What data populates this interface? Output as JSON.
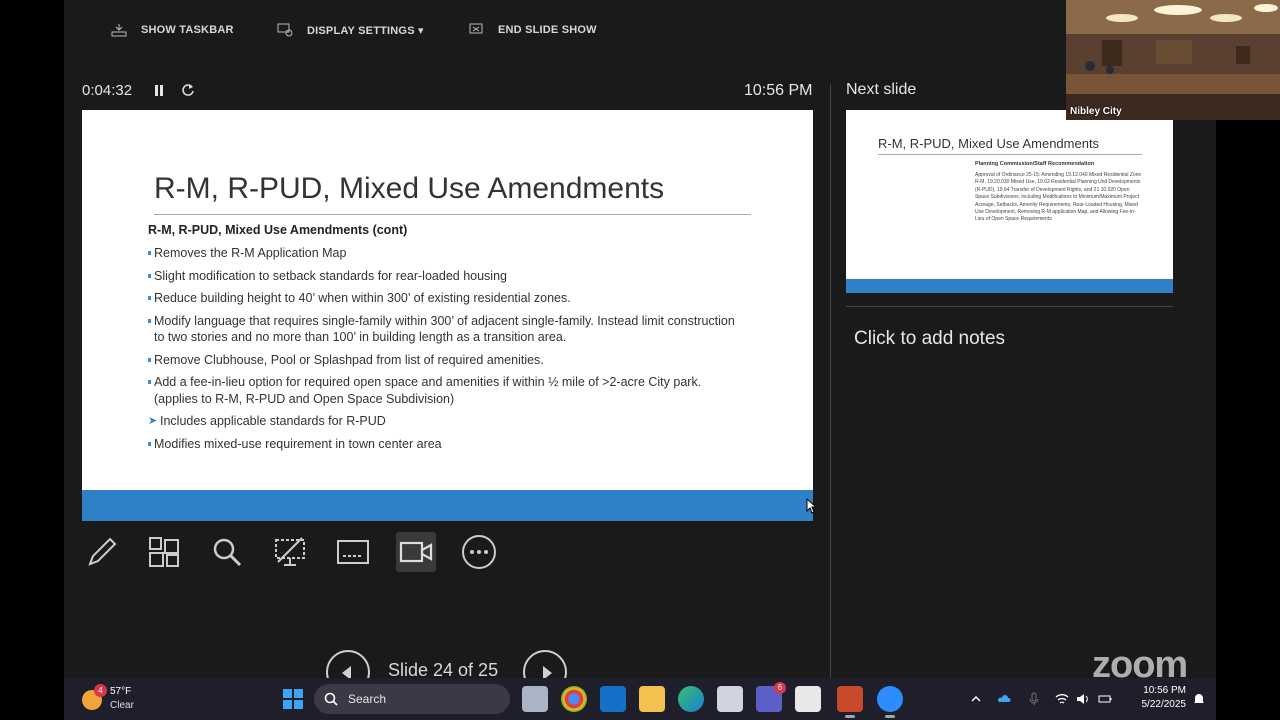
{
  "topbar": {
    "show_taskbar": "SHOW TASKBAR",
    "display_settings": "DISPLAY SETTINGS ▾",
    "end_slide_show": "END SLIDE SHOW"
  },
  "presenter": {
    "timer": "0:04:32",
    "clock": "10:56 PM",
    "next_slide_label": "Next slide",
    "notes_placeholder": "Click to add notes",
    "slide_counter": "Slide 24 of 25"
  },
  "current_slide": {
    "title": "R-M, R-PUD, Mixed Use Amendments",
    "subtitle": "R-M, R-PUD, Mixed Use Amendments (cont)",
    "bullets": [
      "Removes the R-M Application Map",
      "Slight modification to setback standards for rear-loaded housing",
      "Reduce building height to 40’ when within 300’ of existing residential zones.",
      "Modify language that requires single-family within 300’ of adjacent single-family. Instead limit construction to two stories and no more than 100’ in building length as a transition area.",
      "Remove Clubhouse, Pool or Splashpad from list of required amenities.",
      "Add a fee-in-lieu option for required open space and amenities if within ½ mile of >2-acre City park. (applies to R-M, R-PUD and Open Space Subdivision)",
      "Includes applicable standards for R-PUD",
      "Modifies mixed-use requirement in town center area"
    ]
  },
  "next_slide": {
    "title": "R-M, R-PUD, Mixed Use Amendments",
    "heading": "Planning Commission/Staff Recommendation",
    "body": "Approval of Ordinance 25-15: Amending 19.12.040 Mixed Residential Zone R-M, 19.20.030 Mixed Use, 19.62 Residential Planning Unit Developments (R-PUD), 19.64 Transfer of Development Rights, and 21.10.020 Open Space Subdivisions, including Modifications to Minimum/Maximum Project Acreage, Setbacks, Amenity Requirements, Rear-Loaded Housing, Mixed Use Development, Removing R-M application Map, and Allowing Fee-In-Lieu of Open Space Requirements"
  },
  "camera": {
    "label": "Nibley City"
  },
  "watermark": "zoom",
  "taskbar": {
    "weather_badge": "4",
    "temperature": "57°F",
    "condition": "Clear",
    "search_label": "Search",
    "teams_badge": "6",
    "time": "10:56 PM",
    "date": "5/22/2025"
  },
  "colors": {
    "slide_band": "#2f80c6",
    "bullet": "#3a8fd0",
    "presenter_bg": "#1a1a1a",
    "taskbar_bg": "#1f1f2b"
  }
}
